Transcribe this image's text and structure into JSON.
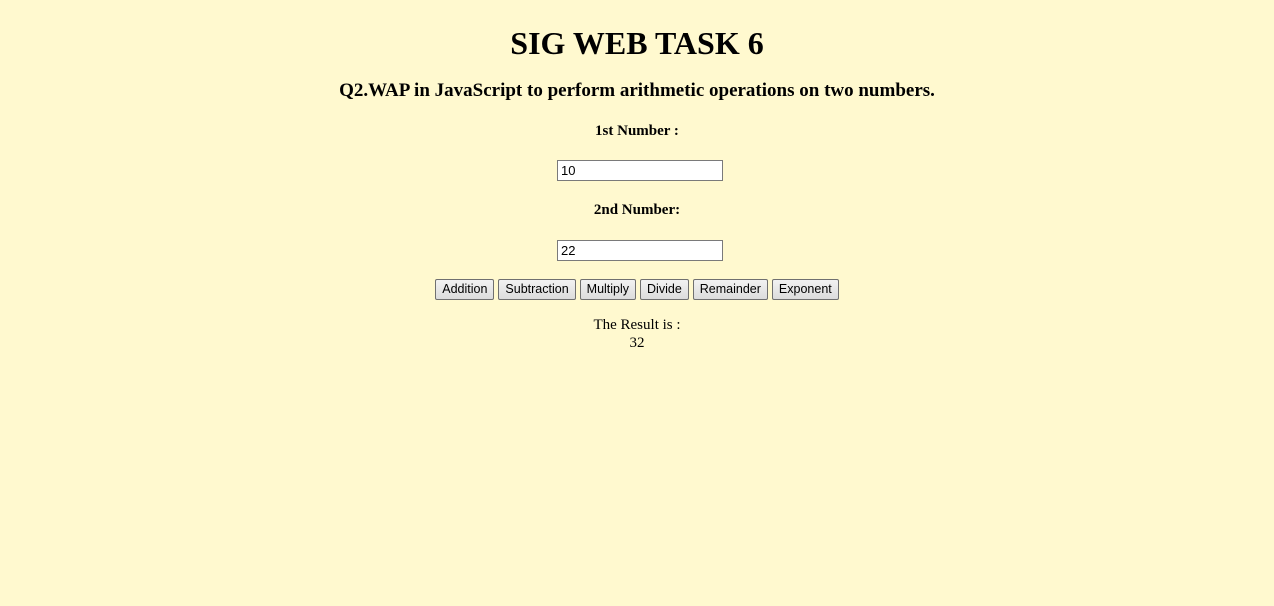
{
  "header": {
    "title": "SIG WEB TASK 6",
    "question": "Q2.WAP in JavaScript to perform arithmetic operations on two numbers."
  },
  "form": {
    "first_label": "1st Number :",
    "first_value": "10",
    "second_label": "2nd Number:",
    "second_value": "22"
  },
  "buttons": {
    "addition": "Addition",
    "subtraction": "Subtraction",
    "multiply": "Multiply",
    "divide": "Divide",
    "remainder": "Remainder",
    "exponent": "Exponent"
  },
  "result": {
    "label": "The Result is :",
    "value": "32"
  },
  "colors": {
    "background": "#fff9cf"
  }
}
